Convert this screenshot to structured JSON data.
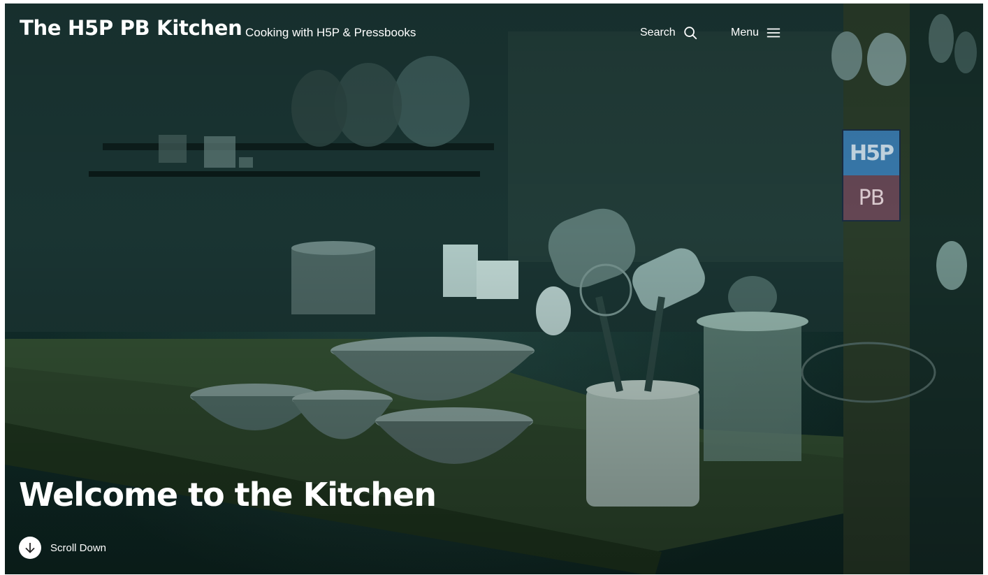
{
  "header": {
    "site_title": "The H5P PB Kitchen",
    "tagline": "Cooking with H5P & Pressbooks",
    "search_label": "Search",
    "search_icon": "search-icon",
    "menu_label": "Menu",
    "menu_icon": "hamburger-menu-icon"
  },
  "hero": {
    "title": "Welcome to the Kitchen",
    "scroll_label": "Scroll Down",
    "scroll_icon": "arrow-down-icon",
    "image_description_icon": "kitchen-photo",
    "sign": {
      "line1": "H5P",
      "line2": "PB"
    }
  },
  "colors": {
    "overlay_tint": "#0f2a25",
    "text": "#ffffff",
    "sign_blue": "#3b7fb4",
    "sign_red": "#b04a4a"
  }
}
